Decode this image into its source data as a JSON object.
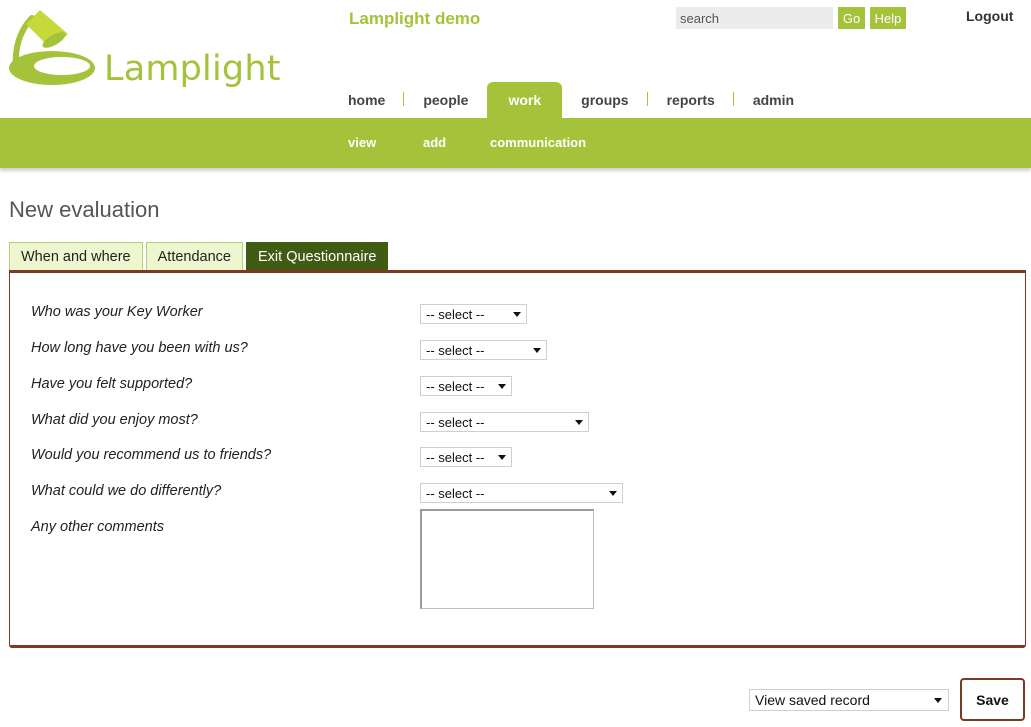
{
  "app": {
    "logo_text": "Lamplight",
    "site_title": "Lamplight demo"
  },
  "header": {
    "search_placeholder": "search",
    "go_label": "Go",
    "help_label": "Help",
    "logout_label": "Logout"
  },
  "nav": {
    "items": [
      {
        "label": "home"
      },
      {
        "label": "people"
      },
      {
        "label": "work",
        "active": true
      },
      {
        "label": "groups"
      },
      {
        "label": "reports"
      },
      {
        "label": "admin"
      }
    ]
  },
  "subnav": {
    "items": [
      {
        "label": "view"
      },
      {
        "label": "add"
      },
      {
        "label": "communication"
      }
    ]
  },
  "page": {
    "title": "New evaluation"
  },
  "tabs": [
    {
      "label": "When and where"
    },
    {
      "label": "Attendance"
    },
    {
      "label": "Exit Questionnaire",
      "active": true
    }
  ],
  "form": {
    "questions": [
      {
        "label": "Who was your Key Worker",
        "value": "-- select --"
      },
      {
        "label": "How long have you been with us?",
        "value": "-- select --"
      },
      {
        "label": "Have you felt supported?",
        "value": "-- select --"
      },
      {
        "label": "What did you enjoy most?",
        "value": "-- select --"
      },
      {
        "label": "Would you recommend us to friends?",
        "value": "-- select --"
      },
      {
        "label": "What could we do differently?",
        "value": "-- select --"
      }
    ],
    "comments_label": "Any other comments",
    "comments_value": ""
  },
  "footer": {
    "view_saved": "View saved record",
    "save_label": "Save"
  },
  "colors": {
    "brand_green": "#a4c33a",
    "tab_active": "#3f5c12",
    "panel_border": "#7a3b22"
  }
}
